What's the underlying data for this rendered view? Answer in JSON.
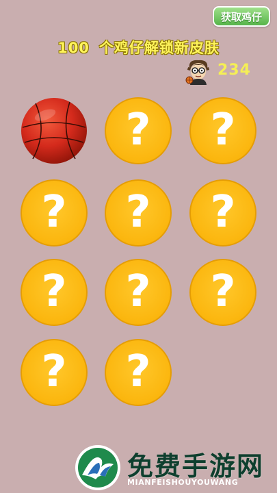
{
  "header": {
    "get_chick_button": "获取鸡仔",
    "unlock_count": "100",
    "unlock_text": "个鸡仔解锁新皮肤",
    "coin_count": "234"
  },
  "grid": {
    "slots": [
      {
        "state": "unlocked",
        "item": "basketball"
      },
      {
        "state": "locked",
        "symbol": "?"
      },
      {
        "state": "locked",
        "symbol": "?"
      },
      {
        "state": "locked",
        "symbol": "?"
      },
      {
        "state": "locked",
        "symbol": "?"
      },
      {
        "state": "locked",
        "symbol": "?"
      },
      {
        "state": "locked",
        "symbol": "?"
      },
      {
        "state": "locked",
        "symbol": "?"
      },
      {
        "state": "locked",
        "symbol": "?"
      },
      {
        "state": "locked",
        "symbol": "?"
      },
      {
        "state": "locked",
        "symbol": "?"
      }
    ]
  },
  "footer": {
    "title": "免费手游网",
    "subtitle": "MIANFEISHOUYOUWANG"
  },
  "colors": {
    "background": "#c9aeaf",
    "locked_slot": "#fbb60e",
    "ball": "#d42a1c",
    "button": "#56b44a",
    "unlock_text": "#fff45c"
  }
}
